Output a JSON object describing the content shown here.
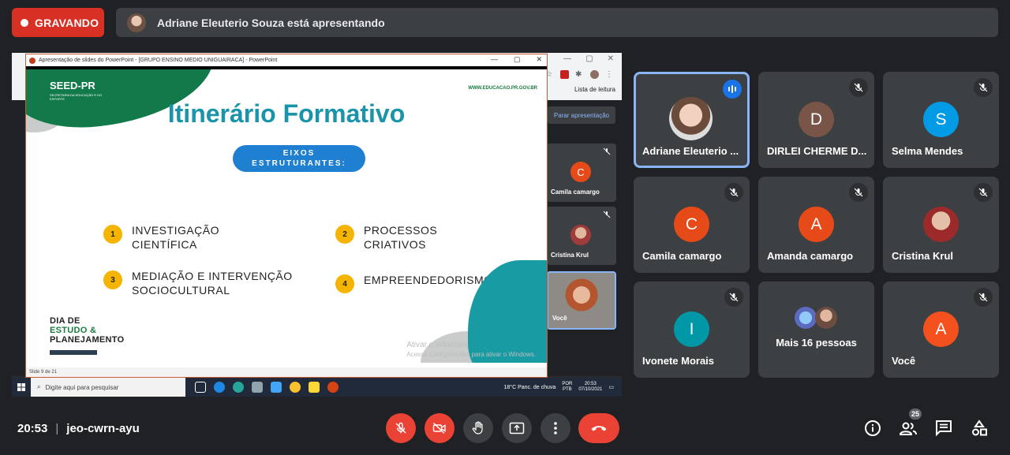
{
  "recording": {
    "label": "GRAVANDO"
  },
  "presenting": {
    "text": "Adriane Eleuterio Souza está apresentando"
  },
  "shared_screen": {
    "ppt_title": "Apresentação de slides do PowerPoint - [GRUPO ENSINO MEDIO  UNIGUAIRACA] - PowerPoint",
    "browser_reading_list": "Lista de leitura",
    "stop_presenting": "Parar apresentação",
    "slide": {
      "logo": "SEED-PR",
      "logo_sub": "SECRETARIA DA EDUCAÇÃO E DO ESPORTE",
      "url": "WWW.EDUCACAO.PR.GOV.BR",
      "title": "Itinerário Formativo",
      "eixos_line1": "EIXOS",
      "eixos_line2": "ESTRUTURANTES:",
      "items": [
        {
          "num": "1",
          "line1": "INVESTIGAÇÃO",
          "line2": "CIENTÍFICA"
        },
        {
          "num": "2",
          "line1": "PROCESSOS",
          "line2": "CRIATIVOS"
        },
        {
          "num": "3",
          "line1": "MEDIAÇÃO E INTERVENÇÃO",
          "line2": "SOCIOCULTURAL"
        },
        {
          "num": "4",
          "line1": "EMPREENDEDORISMO",
          "line2": ""
        }
      ],
      "footer_line1": "DIA DE",
      "footer_line2": "ESTUDO &",
      "footer_line3": "PLANEJAMENTO",
      "activate_title": "Ativar o Windows",
      "activate_sub": "Acesse Configurações para ativar o Windows."
    },
    "slide_status": "Slide 9 de 21",
    "mini_tiles": [
      {
        "name": "Camila camargo",
        "initial": "C"
      },
      {
        "name": "Cristina Krul"
      },
      {
        "name": "Você"
      }
    ],
    "mini_count": "25",
    "taskbar": {
      "search_placeholder": "Digite aqui para pesquisar",
      "weather": "18°C  Panc. de chuva",
      "lang1": "POR",
      "lang2": "PTB",
      "time": "20:53",
      "date": "07/10/2021"
    }
  },
  "participants": [
    {
      "name": "Adriane Eleuterio ...",
      "type": "photo"
    },
    {
      "name": "DIRLEI CHERME D...",
      "initial": "D",
      "color": "#795548"
    },
    {
      "name": "Selma Mendes",
      "initial": "S",
      "color": "#039be5"
    },
    {
      "name": "Camila camargo",
      "initial": "C",
      "color": "#e64a19"
    },
    {
      "name": "Amanda camargo",
      "initial": "A",
      "color": "#e64a19"
    },
    {
      "name": "Cristina Krul",
      "type": "photo"
    },
    {
      "name": "Ivonete Morais",
      "initial": "I",
      "color": "#0097a7"
    },
    {
      "name": "Mais 16 pessoas",
      "type": "more"
    },
    {
      "name": "Você",
      "initial": "A",
      "color": "#f4511e"
    }
  ],
  "bottom": {
    "time": "20:53",
    "meeting_code": "jeo-cwrn-ayu",
    "participant_count": "25"
  },
  "colors": {
    "record": "#d93025",
    "accent": "#8ab4f8",
    "danger": "#ea4335",
    "tile": "#3c4043"
  }
}
